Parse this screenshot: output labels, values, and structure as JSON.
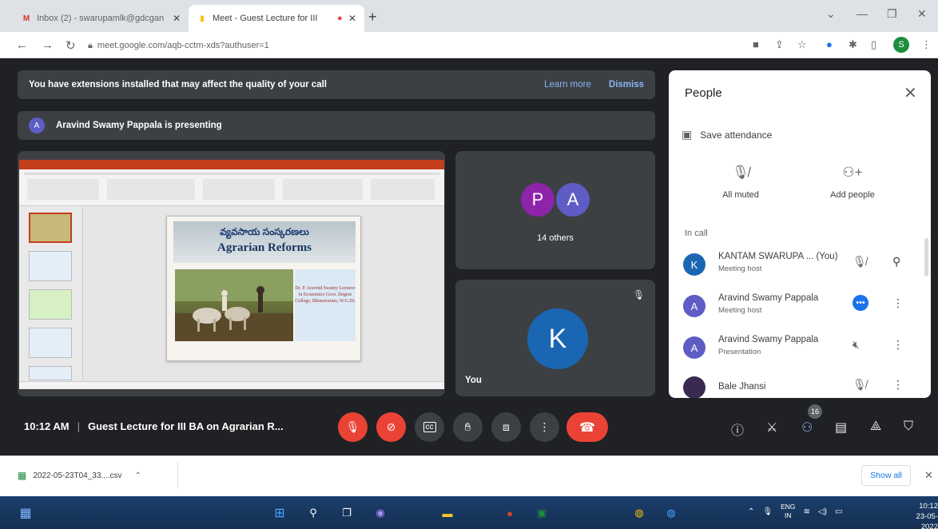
{
  "browser": {
    "tabs": [
      {
        "label": "Inbox (2) - swarupamlk@gdcgan",
        "favicon": "gmail-icon"
      },
      {
        "label": "Meet - Guest Lecture for III",
        "favicon": "meet-icon"
      }
    ],
    "new_tab": "+",
    "url": "meet.google.com/aqb-cctm-xds?authuser=1",
    "profile_initial": "S"
  },
  "banner": {
    "extensions_text": "You have extensions installed that may affect the quality of your call",
    "learn_more": "Learn more",
    "dismiss": "Dismiss",
    "presenter_initial": "A",
    "presenting_text": "Aravind Swamy Pappala is presenting"
  },
  "slide": {
    "telugu_title": "వ్యవసాయ సంస్కరణలు",
    "title": "Agrarian Reforms",
    "info": "Dr. P. Aravind Swamy Lecturer in Economics Govt. Degree College, Bhimavaram, W.G.Dt."
  },
  "tiles": {
    "others_initials": [
      "P",
      "A"
    ],
    "others_label": "14 others",
    "you_initial": "K",
    "you_label": "You"
  },
  "people": {
    "title": "People",
    "save_attendance": "Save attendance",
    "all_muted": "All muted",
    "add_people": "Add people",
    "in_call": "In call",
    "participants": [
      {
        "initial": "K",
        "name": "KANTAM SWARUPA ... (You)",
        "role": "Meeting host",
        "color": "#1a66b2"
      },
      {
        "initial": "A",
        "name": "Aravind Swamy Pappala",
        "role": "Meeting host",
        "color": "#5e5cc5"
      },
      {
        "initial": "A",
        "name": "Aravind Swamy Pappala",
        "role": "Presentation",
        "color": "#5e5cc5"
      },
      {
        "initial": "",
        "name": "Bale Jhansi",
        "role": "",
        "color": "#3a2a50"
      }
    ]
  },
  "meeting": {
    "time": "10:12 AM",
    "separator": "|",
    "title": "Guest Lecture for III BA on Agrarian R...",
    "participant_count": "16"
  },
  "download": {
    "filename": "2022-05-23T04_33....csv",
    "show_all": "Show all"
  },
  "taskbar": {
    "lang": "ENG",
    "region": "IN",
    "time": "10:12",
    "date": "23-05-2022"
  },
  "colors": {
    "meet_bg": "#202124",
    "tile_bg": "#3c4043",
    "red": "#ea4335",
    "accent": "#1a73e8"
  }
}
